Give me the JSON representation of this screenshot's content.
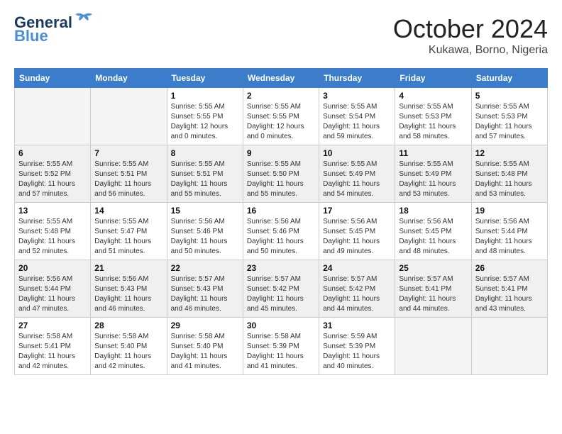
{
  "header": {
    "logo_general": "General",
    "logo_blue": "Blue",
    "month_year": "October 2024",
    "location": "Kukawa, Borno, Nigeria"
  },
  "days_of_week": [
    "Sunday",
    "Monday",
    "Tuesday",
    "Wednesday",
    "Thursday",
    "Friday",
    "Saturday"
  ],
  "weeks": [
    [
      {
        "day": "",
        "empty": true
      },
      {
        "day": "",
        "empty": true
      },
      {
        "day": "1",
        "sunrise": "Sunrise: 5:55 AM",
        "sunset": "Sunset: 5:55 PM",
        "daylight": "Daylight: 12 hours and 0 minutes."
      },
      {
        "day": "2",
        "sunrise": "Sunrise: 5:55 AM",
        "sunset": "Sunset: 5:55 PM",
        "daylight": "Daylight: 12 hours and 0 minutes."
      },
      {
        "day": "3",
        "sunrise": "Sunrise: 5:55 AM",
        "sunset": "Sunset: 5:54 PM",
        "daylight": "Daylight: 11 hours and 59 minutes."
      },
      {
        "day": "4",
        "sunrise": "Sunrise: 5:55 AM",
        "sunset": "Sunset: 5:53 PM",
        "daylight": "Daylight: 11 hours and 58 minutes."
      },
      {
        "day": "5",
        "sunrise": "Sunrise: 5:55 AM",
        "sunset": "Sunset: 5:53 PM",
        "daylight": "Daylight: 11 hours and 57 minutes."
      }
    ],
    [
      {
        "day": "6",
        "sunrise": "Sunrise: 5:55 AM",
        "sunset": "Sunset: 5:52 PM",
        "daylight": "Daylight: 11 hours and 57 minutes."
      },
      {
        "day": "7",
        "sunrise": "Sunrise: 5:55 AM",
        "sunset": "Sunset: 5:51 PM",
        "daylight": "Daylight: 11 hours and 56 minutes."
      },
      {
        "day": "8",
        "sunrise": "Sunrise: 5:55 AM",
        "sunset": "Sunset: 5:51 PM",
        "daylight": "Daylight: 11 hours and 55 minutes."
      },
      {
        "day": "9",
        "sunrise": "Sunrise: 5:55 AM",
        "sunset": "Sunset: 5:50 PM",
        "daylight": "Daylight: 11 hours and 55 minutes."
      },
      {
        "day": "10",
        "sunrise": "Sunrise: 5:55 AM",
        "sunset": "Sunset: 5:49 PM",
        "daylight": "Daylight: 11 hours and 54 minutes."
      },
      {
        "day": "11",
        "sunrise": "Sunrise: 5:55 AM",
        "sunset": "Sunset: 5:49 PM",
        "daylight": "Daylight: 11 hours and 53 minutes."
      },
      {
        "day": "12",
        "sunrise": "Sunrise: 5:55 AM",
        "sunset": "Sunset: 5:48 PM",
        "daylight": "Daylight: 11 hours and 53 minutes."
      }
    ],
    [
      {
        "day": "13",
        "sunrise": "Sunrise: 5:55 AM",
        "sunset": "Sunset: 5:48 PM",
        "daylight": "Daylight: 11 hours and 52 minutes."
      },
      {
        "day": "14",
        "sunrise": "Sunrise: 5:55 AM",
        "sunset": "Sunset: 5:47 PM",
        "daylight": "Daylight: 11 hours and 51 minutes."
      },
      {
        "day": "15",
        "sunrise": "Sunrise: 5:56 AM",
        "sunset": "Sunset: 5:46 PM",
        "daylight": "Daylight: 11 hours and 50 minutes."
      },
      {
        "day": "16",
        "sunrise": "Sunrise: 5:56 AM",
        "sunset": "Sunset: 5:46 PM",
        "daylight": "Daylight: 11 hours and 50 minutes."
      },
      {
        "day": "17",
        "sunrise": "Sunrise: 5:56 AM",
        "sunset": "Sunset: 5:45 PM",
        "daylight": "Daylight: 11 hours and 49 minutes."
      },
      {
        "day": "18",
        "sunrise": "Sunrise: 5:56 AM",
        "sunset": "Sunset: 5:45 PM",
        "daylight": "Daylight: 11 hours and 48 minutes."
      },
      {
        "day": "19",
        "sunrise": "Sunrise: 5:56 AM",
        "sunset": "Sunset: 5:44 PM",
        "daylight": "Daylight: 11 hours and 48 minutes."
      }
    ],
    [
      {
        "day": "20",
        "sunrise": "Sunrise: 5:56 AM",
        "sunset": "Sunset: 5:44 PM",
        "daylight": "Daylight: 11 hours and 47 minutes."
      },
      {
        "day": "21",
        "sunrise": "Sunrise: 5:56 AM",
        "sunset": "Sunset: 5:43 PM",
        "daylight": "Daylight: 11 hours and 46 minutes."
      },
      {
        "day": "22",
        "sunrise": "Sunrise: 5:57 AM",
        "sunset": "Sunset: 5:43 PM",
        "daylight": "Daylight: 11 hours and 46 minutes."
      },
      {
        "day": "23",
        "sunrise": "Sunrise: 5:57 AM",
        "sunset": "Sunset: 5:42 PM",
        "daylight": "Daylight: 11 hours and 45 minutes."
      },
      {
        "day": "24",
        "sunrise": "Sunrise: 5:57 AM",
        "sunset": "Sunset: 5:42 PM",
        "daylight": "Daylight: 11 hours and 44 minutes."
      },
      {
        "day": "25",
        "sunrise": "Sunrise: 5:57 AM",
        "sunset": "Sunset: 5:41 PM",
        "daylight": "Daylight: 11 hours and 44 minutes."
      },
      {
        "day": "26",
        "sunrise": "Sunrise: 5:57 AM",
        "sunset": "Sunset: 5:41 PM",
        "daylight": "Daylight: 11 hours and 43 minutes."
      }
    ],
    [
      {
        "day": "27",
        "sunrise": "Sunrise: 5:58 AM",
        "sunset": "Sunset: 5:41 PM",
        "daylight": "Daylight: 11 hours and 42 minutes."
      },
      {
        "day": "28",
        "sunrise": "Sunrise: 5:58 AM",
        "sunset": "Sunset: 5:40 PM",
        "daylight": "Daylight: 11 hours and 42 minutes."
      },
      {
        "day": "29",
        "sunrise": "Sunrise: 5:58 AM",
        "sunset": "Sunset: 5:40 PM",
        "daylight": "Daylight: 11 hours and 41 minutes."
      },
      {
        "day": "30",
        "sunrise": "Sunrise: 5:58 AM",
        "sunset": "Sunset: 5:39 PM",
        "daylight": "Daylight: 11 hours and 41 minutes."
      },
      {
        "day": "31",
        "sunrise": "Sunrise: 5:59 AM",
        "sunset": "Sunset: 5:39 PM",
        "daylight": "Daylight: 11 hours and 40 minutes."
      },
      {
        "day": "",
        "empty": true
      },
      {
        "day": "",
        "empty": true
      }
    ]
  ]
}
